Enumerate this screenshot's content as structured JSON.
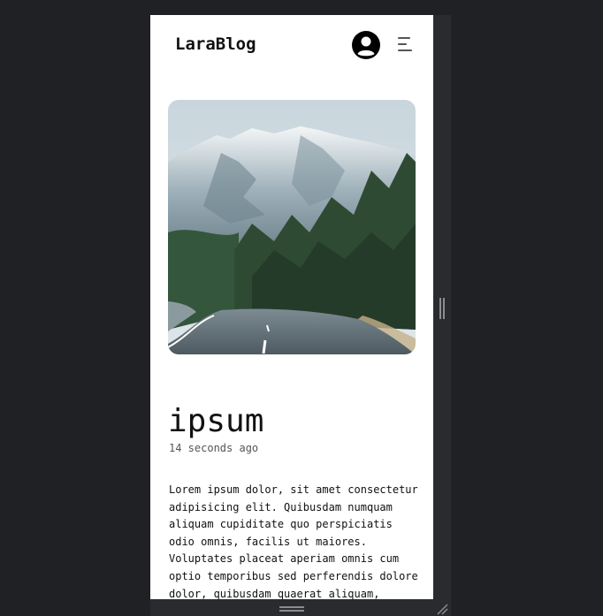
{
  "navbar": {
    "brand": "LaraBlog",
    "icons": {
      "profile": "user-circle-icon",
      "menu": "hamburger-menu-icon"
    }
  },
  "post": {
    "image_alt": "mountain-road-photo",
    "title": "ipsum",
    "time": "14 seconds ago",
    "body": "Lorem ipsum dolor, sit amet consectetur\nadipisicing elit. Quibusdam numquam\naliquam cupiditate quo perspiciatis\nodio omnis, facilis ut maiores.\nVoluptates placeat aperiam omnis cum\noptio temporibus sed perferendis dolore\ndolor, quibusdam quaerat aliquam,"
  },
  "colors": {
    "page_bg": "#202124",
    "viewport_bg": "#ffffff",
    "text": "#111111",
    "muted": "#555555"
  }
}
